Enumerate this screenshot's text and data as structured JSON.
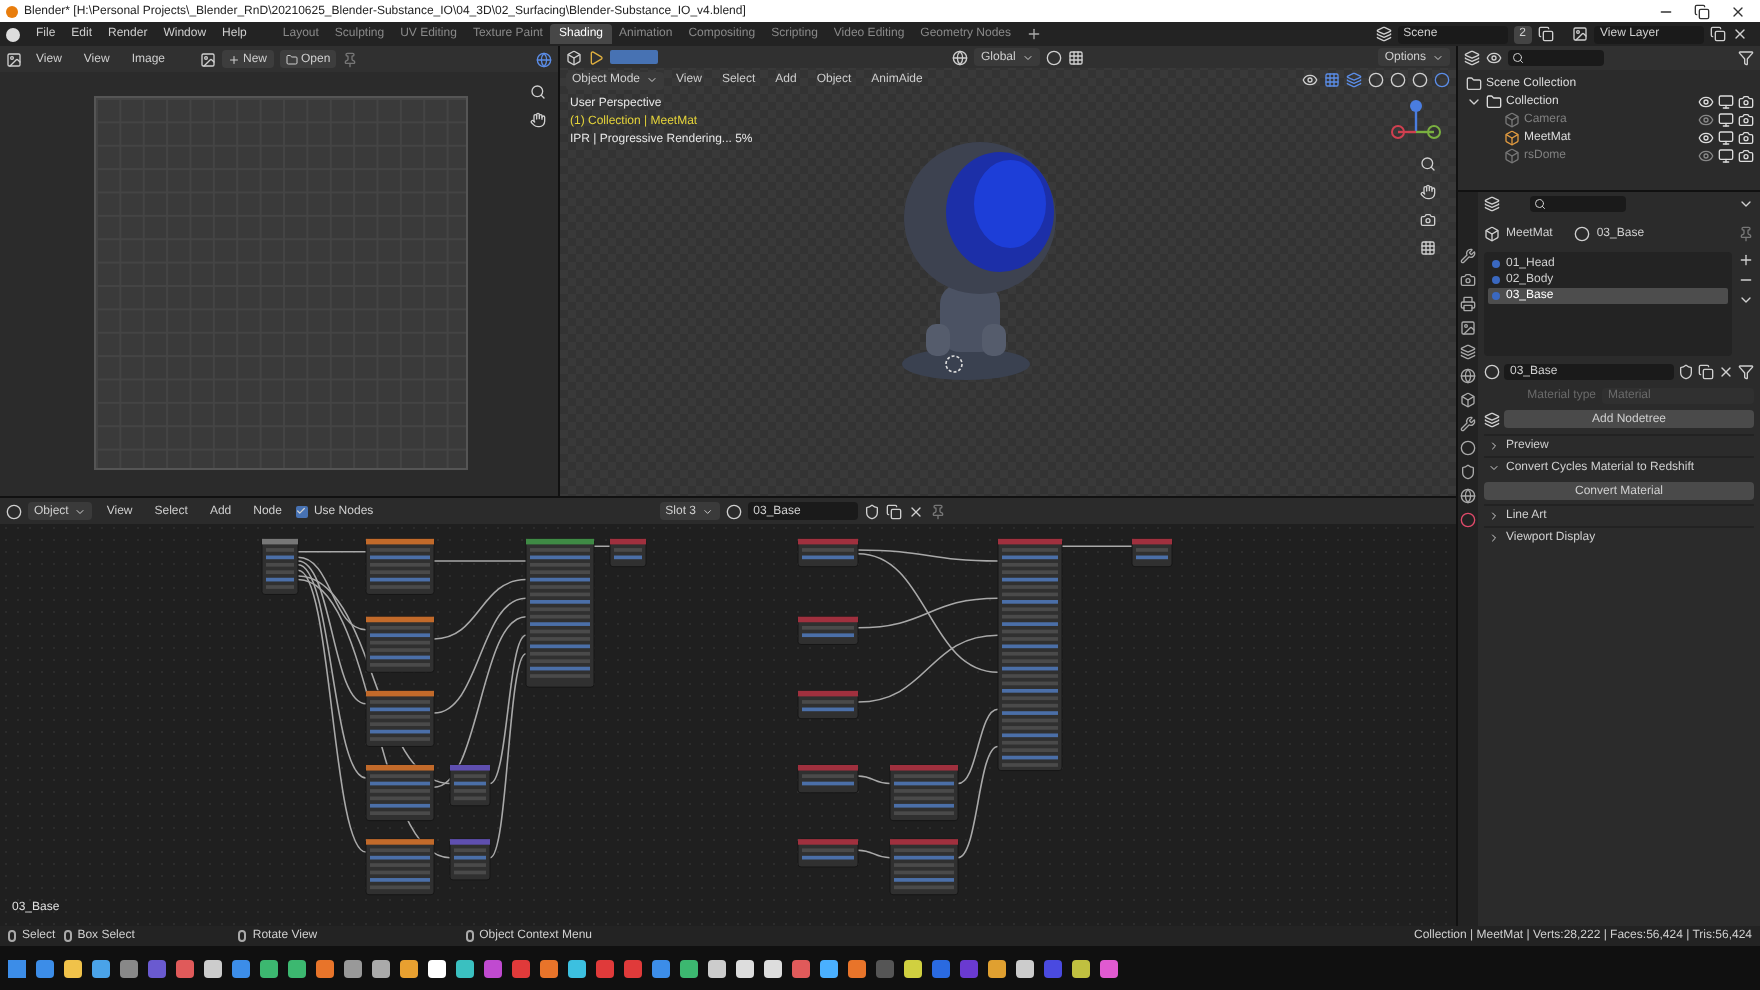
{
  "title_bar": {
    "title": "Blender* [H:\\Personal Projects\\_Blender_RnD\\20210625_Blender-Substance_IO\\04_3D\\02_Surfacing\\Blender-Substance_IO_v4.blend]"
  },
  "menu": [
    "File",
    "Edit",
    "Render",
    "Window",
    "Help"
  ],
  "workspaces": [
    {
      "label": "Layout",
      "selected": false
    },
    {
      "label": "Sculpting",
      "selected": false
    },
    {
      "label": "UV Editing",
      "selected": false
    },
    {
      "label": "Texture Paint",
      "selected": false
    },
    {
      "label": "Shading",
      "selected": true
    },
    {
      "label": "Animation",
      "selected": false
    },
    {
      "label": "Compositing",
      "selected": false
    },
    {
      "label": "Scripting",
      "selected": false
    },
    {
      "label": "Video Editing",
      "selected": false
    },
    {
      "label": "Geometry Nodes",
      "selected": false
    }
  ],
  "scene": {
    "name": "Scene",
    "count": "2"
  },
  "view_layer": "View Layer",
  "image_editor": {
    "menus": [
      "View",
      "View",
      "Image"
    ],
    "new": "New",
    "open": "Open"
  },
  "viewport": {
    "mode": "Object Mode",
    "menus": [
      "View",
      "Select",
      "Add",
      "Object",
      "AnimAide"
    ],
    "orientation": "Global",
    "options": "Options",
    "info": [
      {
        "text": "User Perspective",
        "kind": "plain"
      },
      {
        "text": "(1) Collection | MeetMat",
        "kind": "highlight"
      },
      {
        "text": "IPR | Progressive Rendering... 5%",
        "kind": "plain"
      }
    ]
  },
  "outliner": {
    "root": "Scene Collection",
    "items": [
      {
        "label": "Collection",
        "disabled": false,
        "children": [
          {
            "label": "Camera",
            "disabled": true
          },
          {
            "label": "MeetMat",
            "disabled": false
          },
          {
            "label": "rsDome",
            "disabled": true
          }
        ]
      }
    ]
  },
  "properties": {
    "object": "MeetMat",
    "material": "03_Base",
    "slots": [
      {
        "label": "01_Head",
        "selected": false
      },
      {
        "label": "02_Body",
        "selected": false
      },
      {
        "label": "03_Base",
        "selected": true
      }
    ],
    "material_field": "03_Base",
    "material_type": {
      "label": "Material type",
      "value": "Material",
      "disabled": true
    },
    "add_nodetree": "Add Nodetree",
    "panels": [
      {
        "label": "Preview",
        "expanded": false
      },
      {
        "label": "Convert Cycles Material to Redshift",
        "expanded": true,
        "button": "Convert Material"
      },
      {
        "label": "Line Art",
        "expanded": false
      },
      {
        "label": "Viewport Display",
        "expanded": false
      }
    ]
  },
  "node_editor": {
    "mode": "Object",
    "menus": [
      "View",
      "Select",
      "Add",
      "Node"
    ],
    "use_nodes": {
      "label": "Use Nodes",
      "checked": true
    },
    "slot": "Slot 3",
    "material": "03_Base",
    "canvas_label": "03_Base"
  },
  "status_bar": {
    "hints": [
      "Select",
      "Box Select",
      "Rotate View",
      "Object Context Menu"
    ],
    "stats": "Collection | MeetMat | Verts:28,222 | Faces:56,424 | Tris:56,424"
  }
}
